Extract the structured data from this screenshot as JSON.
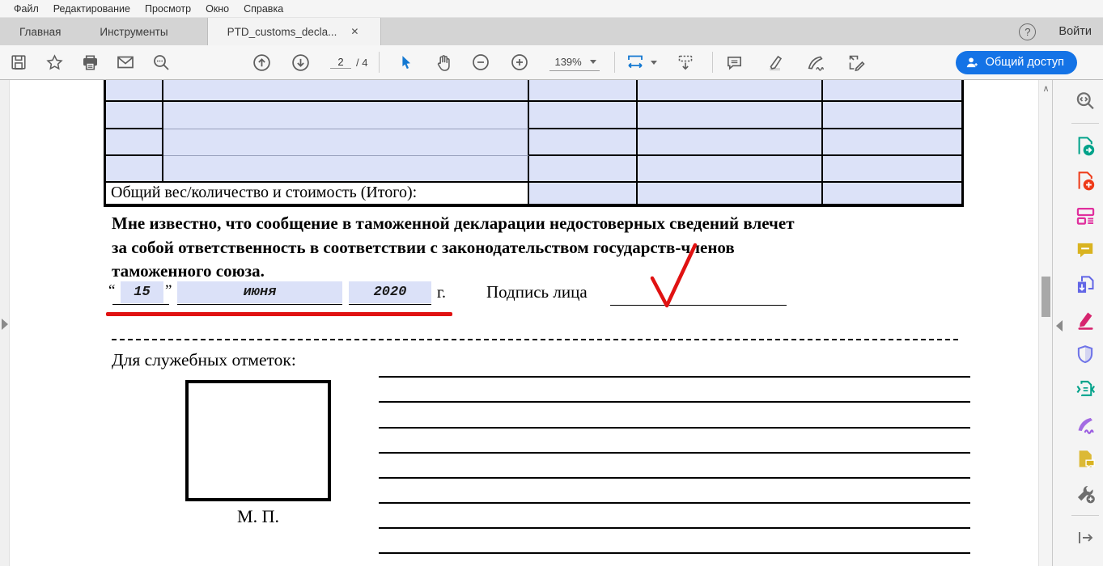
{
  "menu": {
    "items": [
      {
        "label": "Файл"
      },
      {
        "label": "Редактирование"
      },
      {
        "label": "Просмотр"
      },
      {
        "label": "Окно"
      },
      {
        "label": "Справка"
      }
    ]
  },
  "tabs": {
    "home": "Главная",
    "tools": "Инструменты",
    "document": "PTD_customs_decla...",
    "close": "✕",
    "help": "?",
    "sign_in": "Войти"
  },
  "toolbar": {
    "page_current": "2",
    "page_total": "/ 4",
    "zoom_level": "139%",
    "share_label": "Общий доступ",
    "scroll_up_glyph": "∧"
  },
  "document": {
    "table": {
      "total_row_label": "Общий вес/количество и стоимость (Итого):"
    },
    "declaration": {
      "lines": {
        "0": "Мне известно, что сообщение в таможенной декларации недостоверных сведений влечет",
        "1": "за собой ответственность в соответствии с законодательством государств-членов",
        "2": "таможенного союза."
      }
    },
    "date": {
      "open_quote": "“",
      "day": "15",
      "close_quote": "”",
      "month": "июня",
      "year": "2020",
      "suffix": "г."
    },
    "signature_label": "Подпись лица",
    "service_marks_label": "Для служебных отметок:",
    "stamp_label": "М. П."
  },
  "colors": {
    "accent_blue": "#1473e6",
    "tool_active_blue": "#1378d1",
    "field_blue": "#dbe1f8",
    "table_cell_blue": "#dce2f8",
    "annotation_red": "#e01212",
    "icon_gray": "#5e5e5e",
    "sidebar": {
      "tool_search": "#6e6e6e",
      "export_pdf": "#00a28a",
      "create_pdf": "#ee3a18",
      "edit_pdf": "#e02f9d",
      "comment": "#d9b320",
      "combine_files": "#6266e6",
      "redact": "#d6246e",
      "protect": "#6f74e8",
      "compress_pdf": "#00a28a",
      "fill_sign": "#9a5ce0",
      "send_comments": "#d9b320",
      "more_tools": "#6e6e6e",
      "open_panel": "#6e6e6e"
    }
  }
}
